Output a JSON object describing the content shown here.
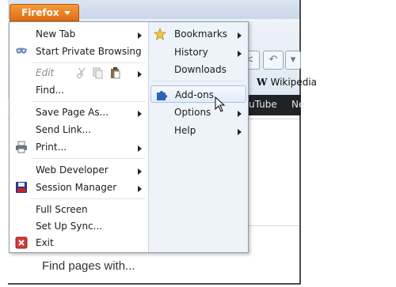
{
  "app_button": {
    "label": "Firefox"
  },
  "page": {
    "find_text": "Find pages with...",
    "wiki_label": "Wikipedia",
    "dark_tabs": [
      "uTube",
      "Ne"
    ]
  },
  "menu_left": {
    "new_tab": "New Tab",
    "private_browsing": "Start Private Browsing",
    "edit": "Edit",
    "find": "Find...",
    "save_page": "Save Page As...",
    "send_link": "Send Link...",
    "print": "Print...",
    "web_developer": "Web Developer",
    "session_manager": "Session Manager",
    "full_screen": "Full Screen",
    "set_up_sync": "Set Up Sync...",
    "exit": "Exit"
  },
  "menu_right": {
    "bookmarks": "Bookmarks",
    "history": "History",
    "downloads": "Downloads",
    "add_ons": "Add-ons",
    "options": "Options",
    "help": "Help"
  },
  "colors": {
    "accent_orange": "#e06c10",
    "menu_right_bg": "#eef3fa",
    "highlight_border": "#a8c2e2"
  },
  "icons": [
    "mask-icon",
    "printer-icon",
    "floppy-icon",
    "close-red-icon",
    "star-icon",
    "puzzle-icon",
    "cursor-icon"
  ]
}
